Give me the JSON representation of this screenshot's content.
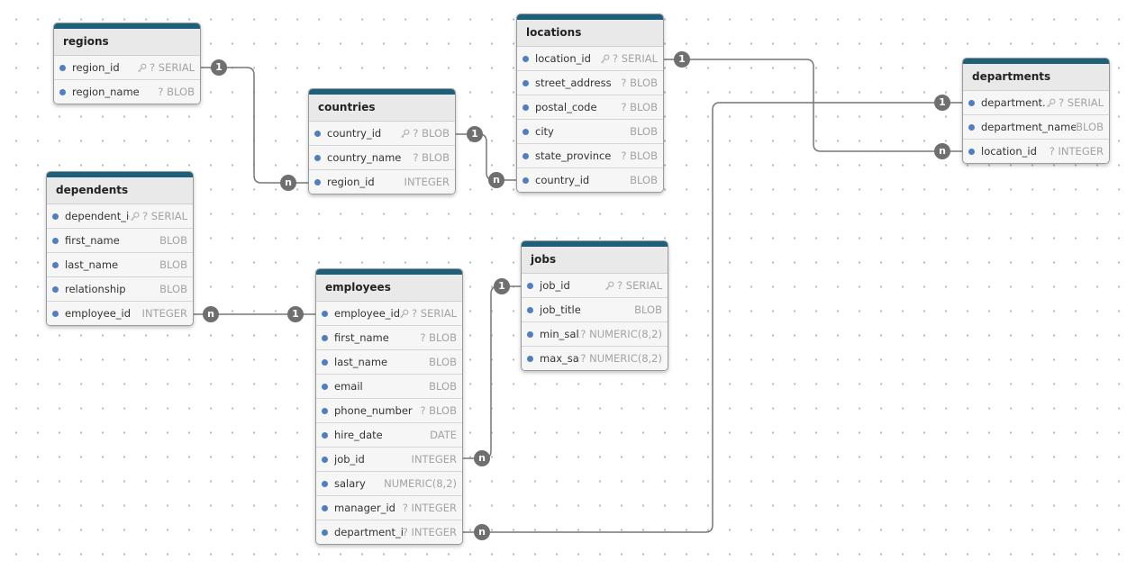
{
  "colors": {
    "header": "#1e5f7a",
    "column_dot": "#4f7fc0",
    "badge": "#6f6f6f",
    "wire": "#777777"
  },
  "tables": [
    {
      "id": "regions",
      "name": "regions",
      "columns": [
        {
          "name": "region_id",
          "type": "? SERIAL",
          "pk": true
        },
        {
          "name": "region_name",
          "type": "? BLOB"
        }
      ]
    },
    {
      "id": "countries",
      "name": "countries",
      "columns": [
        {
          "name": "country_id",
          "type": "? BLOB",
          "pk": true
        },
        {
          "name": "country_name",
          "type": "? BLOB"
        },
        {
          "name": "region_id",
          "type": "INTEGER"
        }
      ]
    },
    {
      "id": "locations",
      "name": "locations",
      "columns": [
        {
          "name": "location_id",
          "type": "? SERIAL",
          "pk": true
        },
        {
          "name": "street_address",
          "type": "? BLOB"
        },
        {
          "name": "postal_code",
          "type": "? BLOB"
        },
        {
          "name": "city",
          "type": "BLOB"
        },
        {
          "name": "state_province",
          "type": "? BLOB"
        },
        {
          "name": "country_id",
          "type": "BLOB"
        }
      ]
    },
    {
      "id": "departments",
      "name": "departments",
      "columns": [
        {
          "name": "department...",
          "type": "? SERIAL",
          "pk": true
        },
        {
          "name": "department_name",
          "type": "BLOB"
        },
        {
          "name": "location_id",
          "type": "? INTEGER"
        }
      ]
    },
    {
      "id": "dependents",
      "name": "dependents",
      "columns": [
        {
          "name": "dependent_id",
          "type": "? SERIAL",
          "pk": true
        },
        {
          "name": "first_name",
          "type": "BLOB"
        },
        {
          "name": "last_name",
          "type": "BLOB"
        },
        {
          "name": "relationship",
          "type": "BLOB"
        },
        {
          "name": "employee_id",
          "type": "INTEGER"
        }
      ]
    },
    {
      "id": "employees",
      "name": "employees",
      "columns": [
        {
          "name": "employee_id",
          "type": "? SERIAL",
          "pk": true
        },
        {
          "name": "first_name",
          "type": "? BLOB"
        },
        {
          "name": "last_name",
          "type": "BLOB"
        },
        {
          "name": "email",
          "type": "BLOB"
        },
        {
          "name": "phone_number",
          "type": "? BLOB"
        },
        {
          "name": "hire_date",
          "type": "DATE"
        },
        {
          "name": "job_id",
          "type": "INTEGER"
        },
        {
          "name": "salary",
          "type": "NUMERIC(8,2)"
        },
        {
          "name": "manager_id",
          "type": "? INTEGER"
        },
        {
          "name": "department_id",
          "type": "? INTEGER"
        }
      ]
    },
    {
      "id": "jobs",
      "name": "jobs",
      "columns": [
        {
          "name": "job_id",
          "type": "? SERIAL",
          "pk": true
        },
        {
          "name": "job_title",
          "type": "BLOB"
        },
        {
          "name": "min_sal...",
          "type": "? NUMERIC(8,2)"
        },
        {
          "name": "max_sal...",
          "type": "? NUMERIC(8,2)"
        }
      ]
    }
  ],
  "relationships": [
    {
      "from": "regions.region_id",
      "to": "countries.region_id",
      "from_card": "1",
      "to_card": "n"
    },
    {
      "from": "countries.country_id",
      "to": "locations.country_id",
      "from_card": "1",
      "to_card": "n"
    },
    {
      "from": "locations.location_id",
      "to": "departments.location_id",
      "from_card": "1",
      "to_card": "n"
    },
    {
      "from": "departments.department_id",
      "to": "employees.department_id",
      "from_card": "1",
      "to_card": "n"
    },
    {
      "from": "employees.employee_id",
      "to": "dependents.employee_id",
      "from_card": "1",
      "to_card": "n"
    },
    {
      "from": "jobs.job_id",
      "to": "employees.job_id",
      "from_card": "1",
      "to_card": "n"
    }
  ]
}
